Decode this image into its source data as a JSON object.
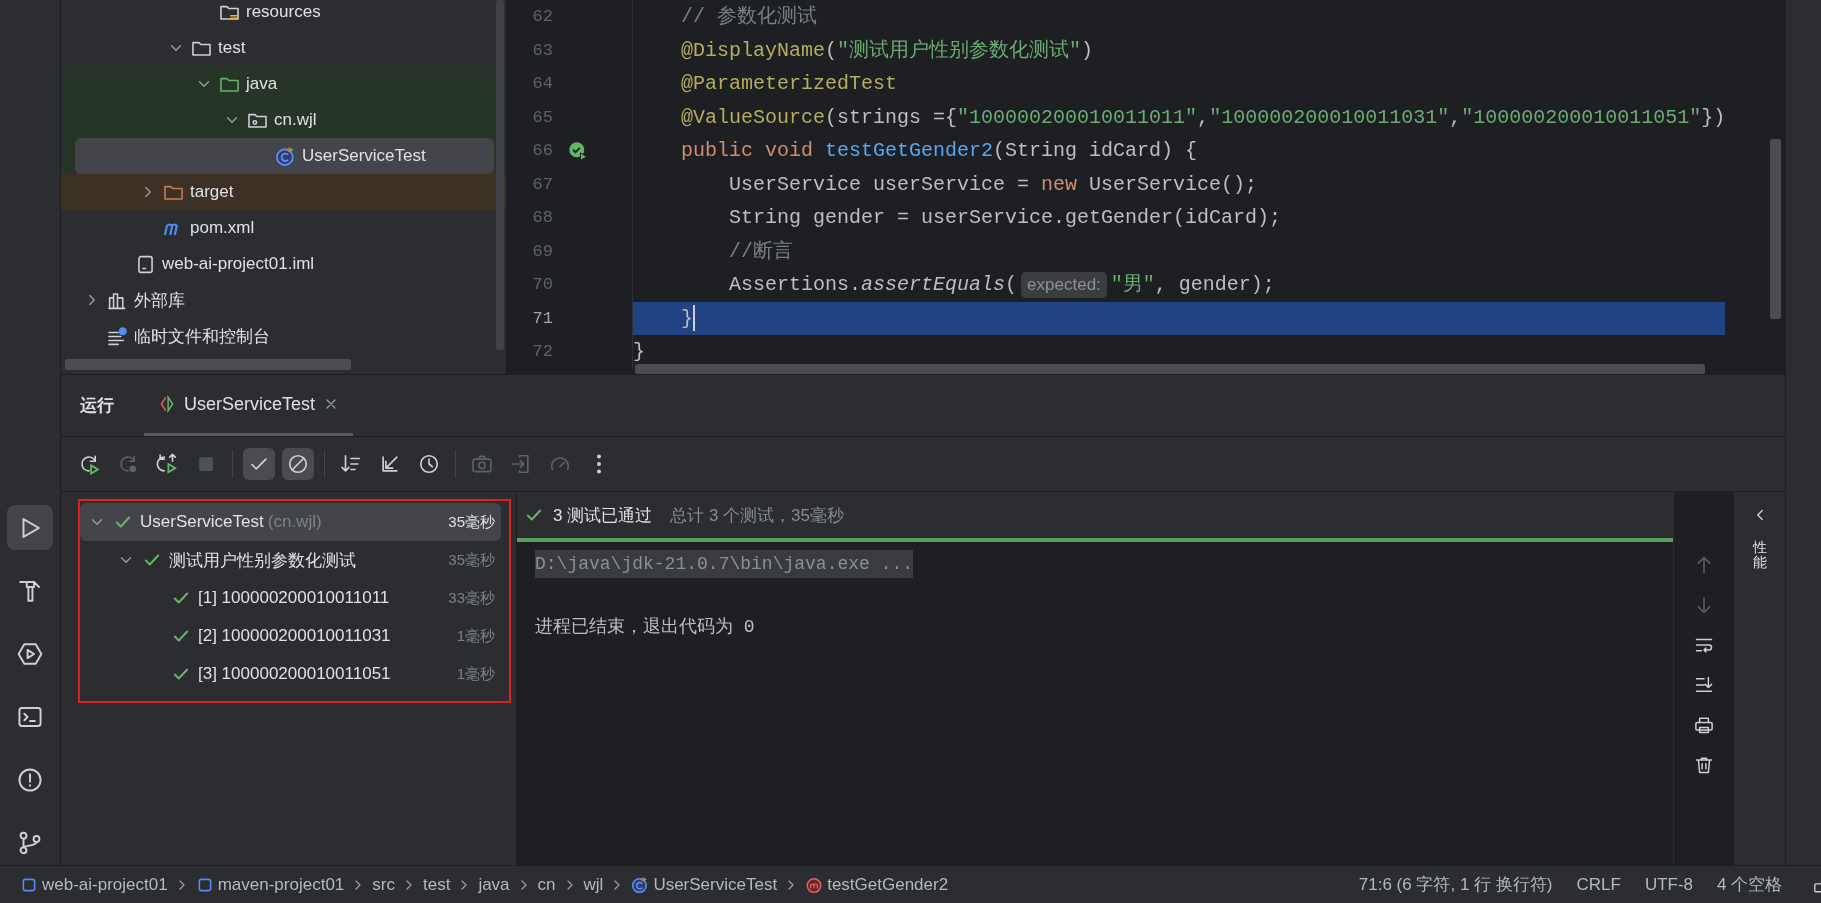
{
  "tool_strip": [
    {
      "kind": "run",
      "selected": true
    },
    {
      "kind": "build",
      "selected": false
    },
    {
      "kind": "services",
      "selected": false
    },
    {
      "kind": "terminal",
      "selected": false
    },
    {
      "kind": "problems",
      "selected": false
    },
    {
      "kind": "git",
      "selected": false
    }
  ],
  "project_tree": {
    "items": [
      {
        "children": [
          {
            "children": [
              {
                "children": [
                  {
                    "children": [
                      {
                        "label": "resources",
                        "kind": "resources"
                      }
                    ]
                  },
                  {
                    "label": "test",
                    "kind": "folder",
                    "expanded": true,
                    "children": [
                      {
                        "label": "java",
                        "kind": "test-root",
                        "expanded": true,
                        "children": [
                          {
                            "label": "cn.wjl",
                            "kind": "package",
                            "expanded": true,
                            "children": [
                              {
                                "label": "UserServiceTest",
                                "kind": "test-class",
                                "selected": true
                              }
                            ]
                          }
                        ]
                      }
                    ]
                  }
                ]
              },
              {
                "label": "target",
                "kind": "excluded",
                "expanded": false
              },
              {
                "label": "pom.xml",
                "kind": "maven"
              }
            ]
          },
          {
            "label": "web-ai-project01.iml",
            "kind": "module"
          }
        ]
      },
      {
        "label": "外部库",
        "kind": "library",
        "expanded": false
      },
      {
        "label": "临时文件和控制台",
        "kind": "scratches"
      }
    ]
  },
  "editor": {
    "lines": [
      {
        "number": "62",
        "run_marker": false,
        "current": false,
        "tokens": [
          {
            "kind": "comment",
            "text": "    // 参数化测试"
          }
        ]
      },
      {
        "number": "63",
        "run_marker": false,
        "current": false,
        "tokens": [
          {
            "kind": "annotation",
            "text": "    @DisplayName"
          },
          {
            "kind": "plain",
            "text": "("
          },
          {
            "kind": "string",
            "text": "\"测试用户性别参数化测试\""
          },
          {
            "kind": "plain",
            "text": ")"
          }
        ]
      },
      {
        "number": "64",
        "run_marker": false,
        "current": false,
        "tokens": [
          {
            "kind": "annotation",
            "text": "    @ParameterizedTest"
          }
        ]
      },
      {
        "number": "65",
        "run_marker": false,
        "current": false,
        "tokens": [
          {
            "kind": "annotation",
            "text": "    @ValueSource"
          },
          {
            "kind": "plain",
            "text": "(strings ={"
          },
          {
            "kind": "string",
            "text": "\"100000200010011011\""
          },
          {
            "kind": "plain",
            "text": ","
          },
          {
            "kind": "string",
            "text": "\"100000200010011031\""
          },
          {
            "kind": "plain",
            "text": ","
          },
          {
            "kind": "string",
            "text": "\"100000200010011051\""
          },
          {
            "kind": "plain",
            "text": "})"
          }
        ]
      },
      {
        "number": "66",
        "run_marker": true,
        "current": false,
        "tokens": [
          {
            "kind": "keyword",
            "text": "    public void "
          },
          {
            "kind": "function",
            "text": "testGetGender2"
          },
          {
            "kind": "plain",
            "text": "(String idCard) {"
          }
        ]
      },
      {
        "number": "67",
        "run_marker": false,
        "current": false,
        "tokens": [
          {
            "kind": "plain",
            "text": "        UserService userService = "
          },
          {
            "kind": "keyword",
            "text": "new "
          },
          {
            "kind": "plain",
            "text": "UserService();"
          }
        ]
      },
      {
        "number": "68",
        "run_marker": false,
        "current": false,
        "tokens": [
          {
            "kind": "plain",
            "text": "        String gender = userService.getGender(idCard);"
          }
        ]
      },
      {
        "number": "69",
        "run_marker": false,
        "current": false,
        "tokens": [
          {
            "kind": "comment",
            "text": "        //断言"
          }
        ]
      },
      {
        "number": "70",
        "run_marker": false,
        "current": false,
        "tokens": [
          {
            "kind": "plain",
            "text": "        Assertions."
          },
          {
            "kind": "italic",
            "text": "assertEquals"
          },
          {
            "kind": "plain",
            "text": "("
          },
          {
            "kind": "hint",
            "text": "expected:"
          },
          {
            "kind": "string",
            "text": "\"男\""
          },
          {
            "kind": "plain",
            "text": ", gender);"
          }
        ]
      },
      {
        "number": "71",
        "run_marker": false,
        "current": true,
        "tokens": [
          {
            "kind": "plain",
            "text": "    }"
          }
        ]
      },
      {
        "number": "72",
        "run_marker": false,
        "current": false,
        "tokens": [
          {
            "kind": "plain",
            "text": "}"
          }
        ]
      }
    ]
  },
  "run_panel": {
    "title": "运行",
    "tabs": [
      {
        "label": "UserServiceTest",
        "selected": true
      }
    ],
    "toolbar": [
      {
        "kind": "rerun",
        "disabled": false,
        "on": false
      },
      {
        "kind": "rerun-failed",
        "disabled": true,
        "on": false
      },
      {
        "kind": "toggle-auto",
        "disabled": false,
        "on": false
      },
      {
        "kind": "stop",
        "disabled": true,
        "on": false
      },
      {
        "kind": "check",
        "disabled": false,
        "on": true
      },
      {
        "kind": "ban",
        "disabled": false,
        "on": true
      },
      {
        "kind": "sort",
        "disabled": false,
        "on": false
      },
      {
        "kind": "collapse",
        "disabled": false,
        "on": false
      },
      {
        "kind": "history",
        "disabled": false,
        "on": false
      },
      {
        "kind": "camera",
        "disabled": true,
        "on": false
      },
      {
        "kind": "import",
        "disabled": true,
        "on": false
      },
      {
        "kind": "gauge",
        "disabled": true,
        "on": false
      },
      {
        "kind": "more",
        "disabled": false,
        "on": false
      }
    ],
    "test_results": {
      "annotated": true,
      "items": [
        {
          "label": "UserServiceTest",
          "qualifier": "(cn.wjl)",
          "time": "35毫秒",
          "passed": true,
          "expanded": true,
          "selected": true,
          "children": [
            {
              "label": "测试用户性别参数化测试",
              "time": "35毫秒",
              "passed": true,
              "expanded": true,
              "selected": false,
              "children": [
                {
                  "label": "[1] 100000200010011011",
                  "time": "33毫秒",
                  "passed": true,
                  "selected": false
                },
                {
                  "label": "[2] 100000200010011031",
                  "time": "1毫秒",
                  "passed": true,
                  "selected": false
                },
                {
                  "label": "[3] 100000200010011051",
                  "time": "1毫秒",
                  "passed": true,
                  "selected": false
                }
              ]
            }
          ]
        }
      ]
    },
    "console": {
      "status": "3 测试已通过",
      "detail": "总计 3 个测试，35毫秒",
      "passed": true,
      "level": 1,
      "lines": [
        {
          "kind": "command",
          "text": "D:\\java\\jdk-21.0.7\\bin\\java.exe ..."
        },
        {
          "kind": "output",
          "text": "进程已结束，退出代码为 0"
        }
      ],
      "actions": [
        {
          "kind": "up",
          "disabled": true
        },
        {
          "kind": "down",
          "disabled": true
        },
        {
          "kind": "wrap",
          "disabled": false
        },
        {
          "kind": "scroll-end",
          "disabled": false
        },
        {
          "kind": "print",
          "disabled": false
        },
        {
          "kind": "trash",
          "disabled": false
        }
      ]
    },
    "side_label": "性能"
  },
  "status_bar": {
    "breadcrumbs": [
      {
        "text": "web-ai-project01",
        "kind": "module"
      },
      {
        "text": "maven-project01",
        "kind": "module"
      },
      {
        "text": "src",
        "kind": "plain"
      },
      {
        "text": "test",
        "kind": "plain"
      },
      {
        "text": "java",
        "kind": "plain"
      },
      {
        "text": "cn",
        "kind": "plain"
      },
      {
        "text": "wjl",
        "kind": "plain"
      },
      {
        "text": "UserServiceTest",
        "kind": "class"
      },
      {
        "text": "testGetGender2",
        "kind": "method"
      }
    ],
    "items": [
      "71:6 (6 字符, 1 行 换行符)",
      "CRLF",
      "UTF-8",
      "4 个空格"
    ]
  }
}
